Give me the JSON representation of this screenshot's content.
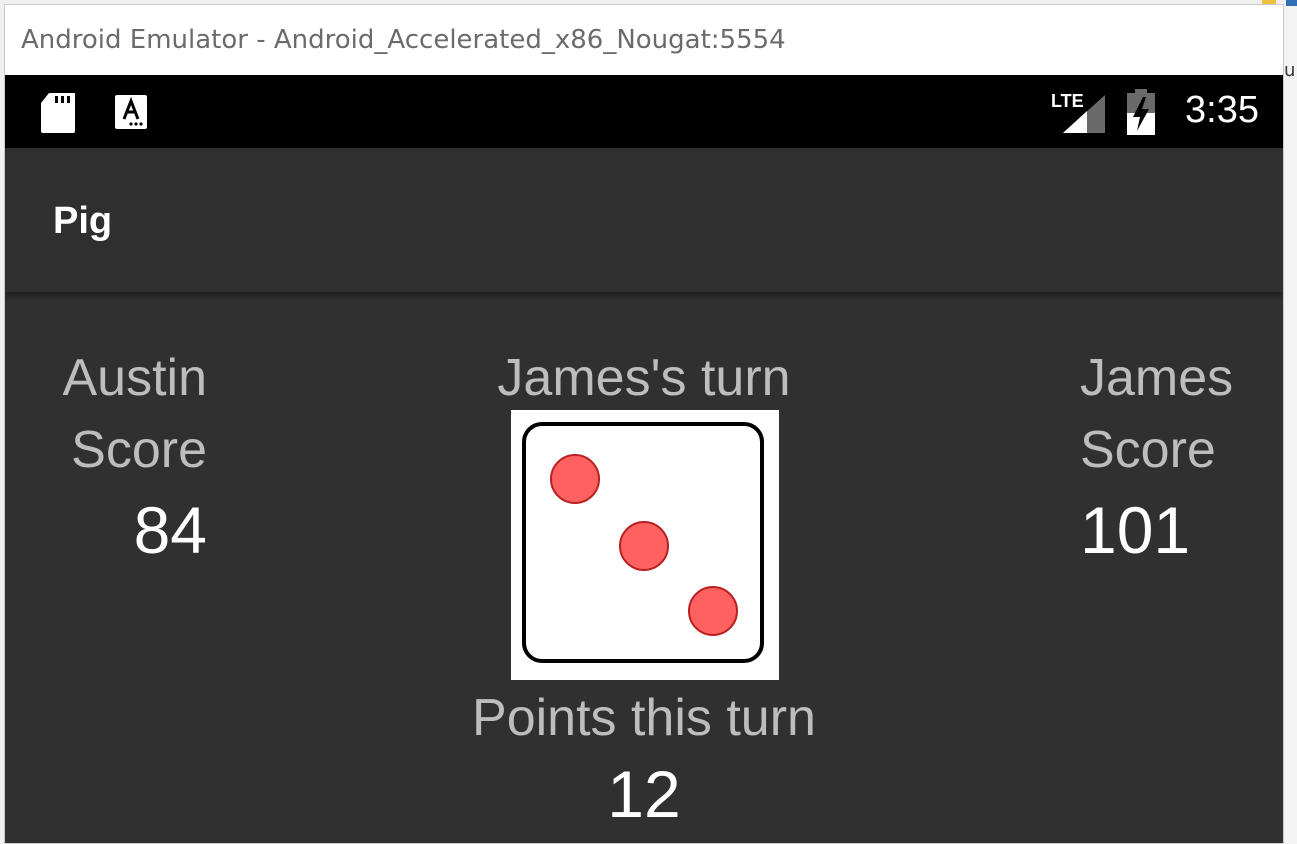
{
  "window": {
    "title": "Android Emulator - Android_Accelerated_x86_Nougat:5554"
  },
  "status_bar": {
    "time": "3:35",
    "network": "LTE",
    "icons": [
      "sd-card-icon",
      "keyboard-a-icon",
      "lte-signal-icon",
      "battery-charging-icon"
    ]
  },
  "app_bar": {
    "title": "Pig"
  },
  "game": {
    "player1": {
      "name": "Austin",
      "score_label": "Score",
      "score": "84"
    },
    "player2": {
      "name": "James",
      "score_label": "Score",
      "score": "101"
    },
    "turn_text": "James's turn",
    "die": {
      "face": 3,
      "pip_color": "#ff6060"
    },
    "points_label": "Points this turn",
    "points_value": "12"
  },
  "colors": {
    "device_bg": "#303030",
    "status_bar": "#000000",
    "label_text": "#bdbdbd",
    "value_text": "#ffffff"
  }
}
